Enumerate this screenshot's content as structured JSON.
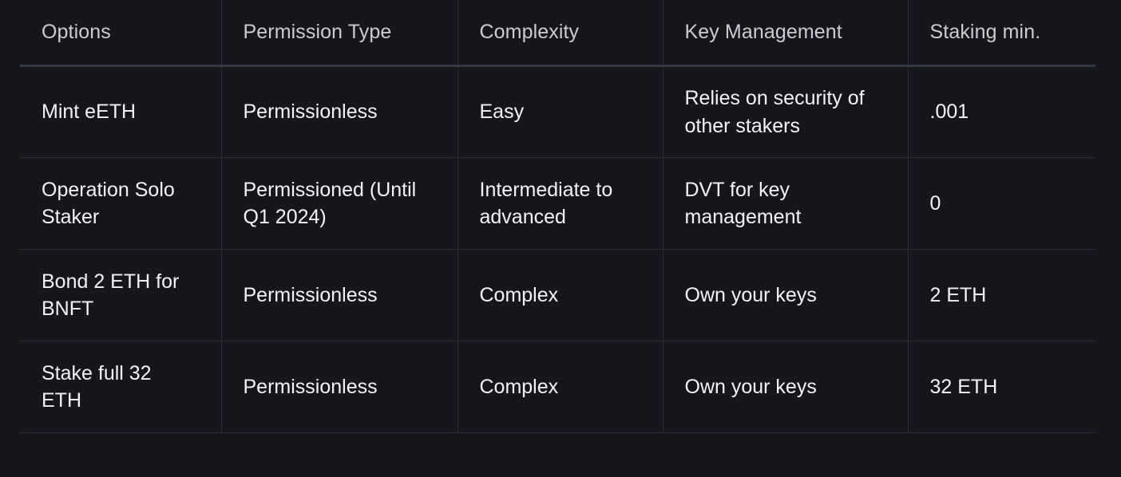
{
  "table": {
    "name": "staking-options-comparison",
    "columns": [
      {
        "key": "options",
        "label": "Options"
      },
      {
        "key": "permission_type",
        "label": "Permission Type"
      },
      {
        "key": "complexity",
        "label": "Complexity"
      },
      {
        "key": "key_management",
        "label": "Key Management"
      },
      {
        "key": "staking_min",
        "label": "Staking min."
      }
    ],
    "rows": [
      {
        "options": "Mint eETH",
        "permission_type": "Permissionless",
        "complexity": "Easy",
        "key_management": "Relies on security of other stakers",
        "staking_min": ".001"
      },
      {
        "options": "Operation Solo Staker",
        "permission_type": "Permissioned (Until Q1 2024)",
        "complexity": "Intermediate to advanced",
        "key_management": "DVT for key management",
        "staking_min": "0"
      },
      {
        "options": "Bond 2 ETH for BNFT",
        "permission_type": "Permissionless",
        "complexity": "Complex",
        "key_management": "Own your keys",
        "staking_min": "2 ETH"
      },
      {
        "options": "Stake full 32 ETH",
        "permission_type": "Permissionless",
        "complexity": "Complex",
        "key_management": "Own your keys",
        "staking_min": "32 ETH"
      }
    ]
  },
  "colors": {
    "background": "#15171c",
    "page_background": "#121419",
    "header_text": "#c9ccd2",
    "body_text": "#f2f3f5",
    "divider": "#2a2e38",
    "header_rule": "#343946"
  }
}
